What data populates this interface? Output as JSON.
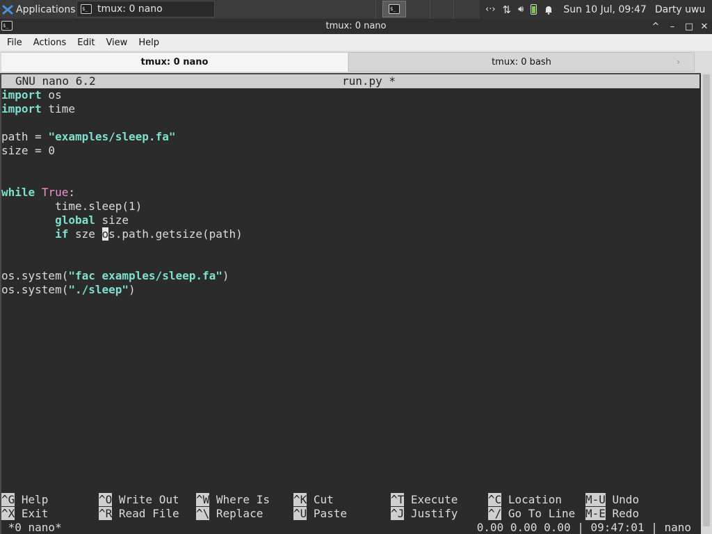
{
  "panel": {
    "applications_label": "Applications",
    "task_label": "tmux: 0 nano",
    "clock": "Sun 10 Jul, 09:47",
    "user": "Darty uwu",
    "icons": [
      "xfce-logo-icon",
      "terminal-icon",
      "network-icon",
      "transfer-icon",
      "volume-icon",
      "battery-icon",
      "notification-bell-icon"
    ]
  },
  "window": {
    "title": "tmux: 0 nano",
    "buttons": {
      "minimize": "^",
      "restore": "–",
      "maximize": "□",
      "close": "✕"
    }
  },
  "menubar": {
    "items": [
      "File",
      "Actions",
      "Edit",
      "View",
      "Help"
    ]
  },
  "tabs": [
    {
      "label": "tmux: 0 nano",
      "active": true
    },
    {
      "label": "tmux: 0 bash",
      "active": false
    }
  ],
  "nano": {
    "version": "GNU nano 6.2",
    "filename": "run.py *",
    "lines": [
      [
        {
          "t": "import",
          "c": "kw-cyan"
        },
        {
          "t": " os"
        }
      ],
      [
        {
          "t": "import",
          "c": "kw-cyan"
        },
        {
          "t": " time"
        }
      ],
      [],
      [
        {
          "t": "path = "
        },
        {
          "t": "\"examples/sleep.fa\"",
          "c": "str"
        }
      ],
      [
        {
          "t": "size = 0"
        }
      ],
      [],
      [],
      [
        {
          "t": "while",
          "c": "kw-cyan"
        },
        {
          "t": " "
        },
        {
          "t": "True",
          "c": "kw-pink"
        },
        {
          "t": ":"
        }
      ],
      [
        {
          "t": "        time.sleep(1)"
        }
      ],
      [
        {
          "t": "        "
        },
        {
          "t": "global",
          "c": "kw-cyan"
        },
        {
          "t": " size"
        }
      ],
      [
        {
          "t": "        "
        },
        {
          "t": "if",
          "c": "kw-cyan"
        },
        {
          "t": " sze "
        },
        {
          "t": "o",
          "c": "cursor"
        },
        {
          "t": "s.path.getsize(path)"
        }
      ],
      [],
      [],
      [
        {
          "t": "os.system("
        },
        {
          "t": "\"fac examples/sleep.fa\"",
          "c": "str"
        },
        {
          "t": ")"
        }
      ],
      [
        {
          "t": "os.system("
        },
        {
          "t": "\"./sleep\"",
          "c": "str"
        },
        {
          "t": ")"
        }
      ]
    ],
    "shortcuts_row1": [
      {
        "key": "^G",
        "label": "Help"
      },
      {
        "key": "^O",
        "label": "Write Out"
      },
      {
        "key": "^W",
        "label": "Where Is"
      },
      {
        "key": "^K",
        "label": "Cut"
      },
      {
        "key": "^T",
        "label": "Execute"
      },
      {
        "key": "^C",
        "label": "Location"
      },
      {
        "key": "M-U",
        "label": "Undo"
      }
    ],
    "shortcuts_row2": [
      {
        "key": "^X",
        "label": "Exit"
      },
      {
        "key": "^R",
        "label": "Read File"
      },
      {
        "key": "^\\",
        "label": "Replace"
      },
      {
        "key": "^U",
        "label": "Paste"
      },
      {
        "key": "^J",
        "label": "Justify"
      },
      {
        "key": "^/",
        "label": "Go To Line"
      },
      {
        "key": "M-E",
        "label": "Redo"
      }
    ]
  },
  "tmux_status": {
    "left": " *0 nano*",
    "right": "0.00 0.00 0.00 | 09:47:01 | nano"
  }
}
